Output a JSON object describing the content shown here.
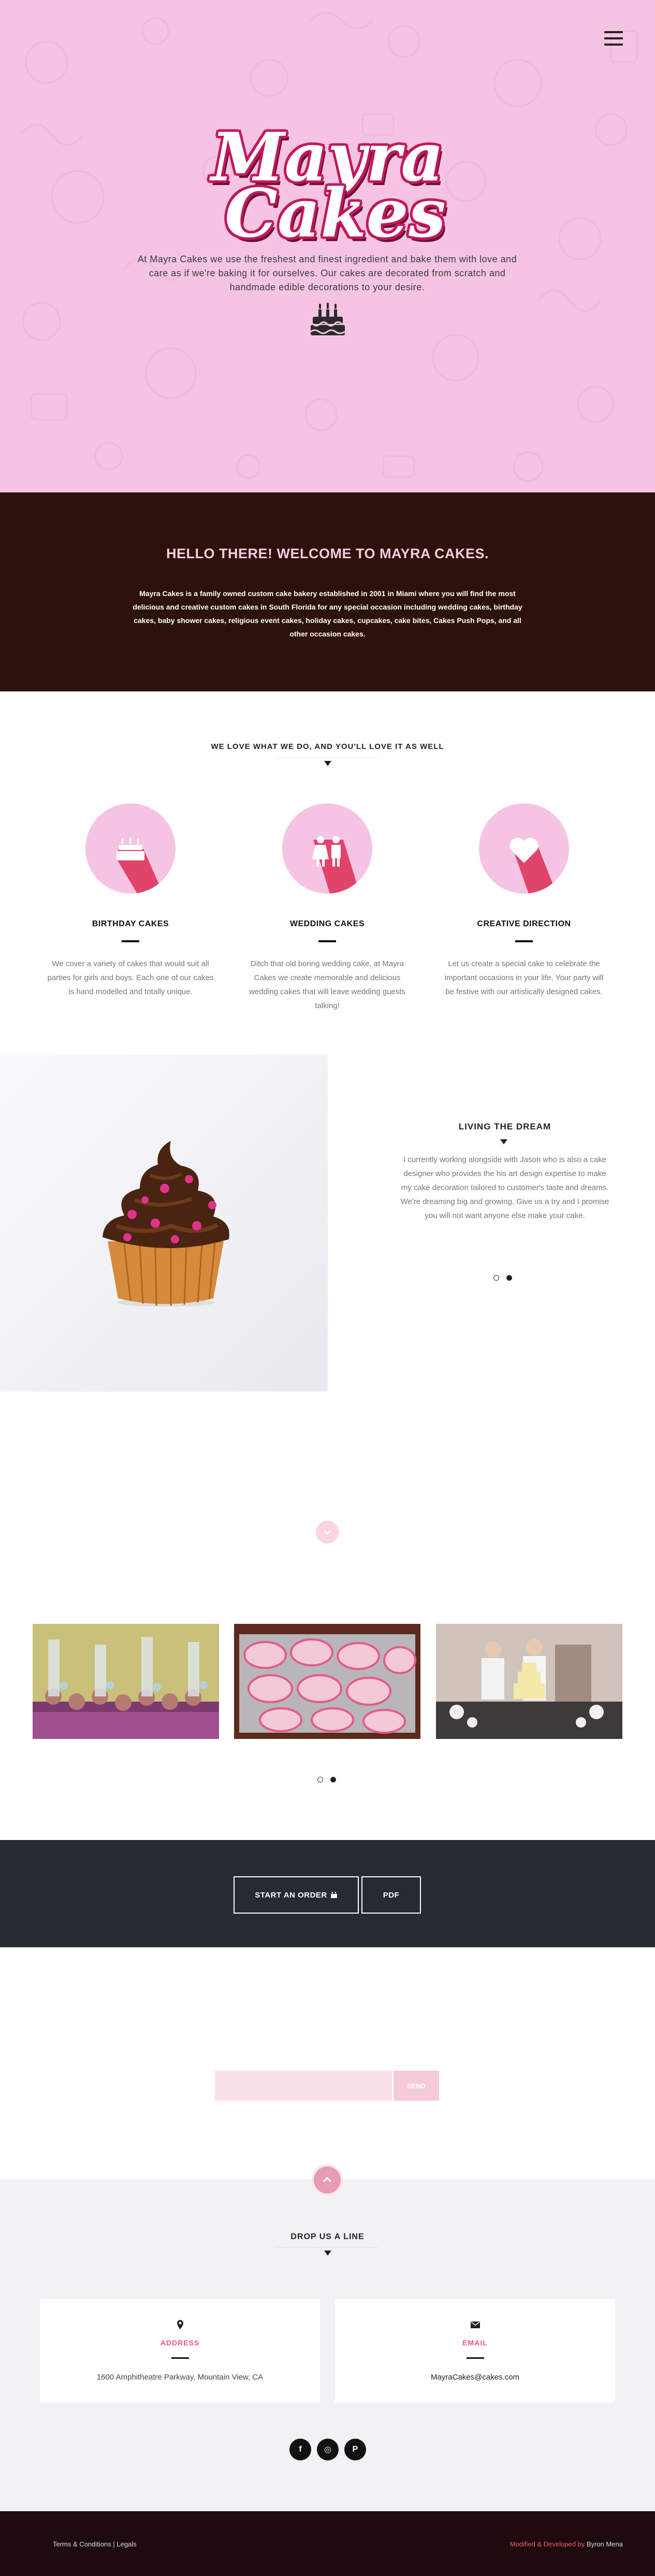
{
  "hero": {
    "logo_line1": "Mayra",
    "logo_line2": "Cakes",
    "text": "At Mayra Cakes we use the freshest and finest ingredient and bake them with love and care as if we're baking it for ourselves. Our cakes are decorated from scratch and handmade edible decorations to your desire."
  },
  "welcome": {
    "title": "HELLO THERE! WELCOME TO MAYRA CAKES.",
    "text": "Mayra Cakes is a family owned custom cake bakery established in 2001 in Miami where you will find the most delicious and creative custom cakes in South Florida for any special occasion including wedding cakes, birthday cakes, baby shower cakes, religious event cakes, holiday cakes, cupcakes, cake bites, Cakes Push Pops, and all other occasion cakes."
  },
  "services": {
    "title": "WE LOVE WHAT WE DO, AND YOU'LL LOVE IT AS WELL",
    "items": [
      {
        "title": "BIRTHDAY CAKES",
        "text": "We cover a variety of cakes that would suit all parties for girls and boys. Each one of our cakes is hand modelled and totally unique.",
        "icon": "birthday-cake-icon"
      },
      {
        "title": "WEDDING CAKES",
        "text": "Ditch that old boring wedding cake, at Mayra Cakes we create memorable and delicious wedding cakes that will leave wedding guests talking!",
        "icon": "bride-groom-icon"
      },
      {
        "title": "CREATIVE DIRECTION",
        "text": "Let us create a special cake to celebrate the important occasions in your life. Your party will be festive with our artistically designed cakes.",
        "icon": "heart-icon"
      }
    ]
  },
  "dream": {
    "title": "LIVING THE DREAM",
    "text": "I currently working alongside with Jason who is also a cake designer who provides the his art design expertise to make my cake decoration tailored to customer's taste and dreams. We're dreaming big and growing. Give us a try and I promise you will not want anyone else make your cake."
  },
  "order": {
    "start_label": "START AN ORDER",
    "pdf_label": "PDF"
  },
  "subscribe": {
    "placeholder": "",
    "button_label": "SEND"
  },
  "contact": {
    "title": "DROP US A LINE",
    "address_label": "ADDRESS",
    "address_value": "1600 Amphitheatre Parkway, Mountain View, CA",
    "email_label": "EMAIL",
    "email_value": "MayraCakes@cakes.com",
    "social": [
      {
        "label": "f",
        "icon": "facebook-icon"
      },
      {
        "label": "◎",
        "icon": "instagram-icon"
      },
      {
        "label": "P",
        "icon": "pinterest-icon"
      }
    ]
  },
  "footer": {
    "terms": "Terms & Conditions",
    "separator": "|",
    "legals": "Legals",
    "credit_prefix": "Modified & Developed by",
    "credit_name": "Byron Mena"
  },
  "colors": {
    "hero_pink": "#f5c4e3",
    "welcome_brown": "#2c120a",
    "accent_pink": "#ef5573",
    "dark_bar": "#262a33",
    "footer_bg": "#1f0b0e"
  }
}
